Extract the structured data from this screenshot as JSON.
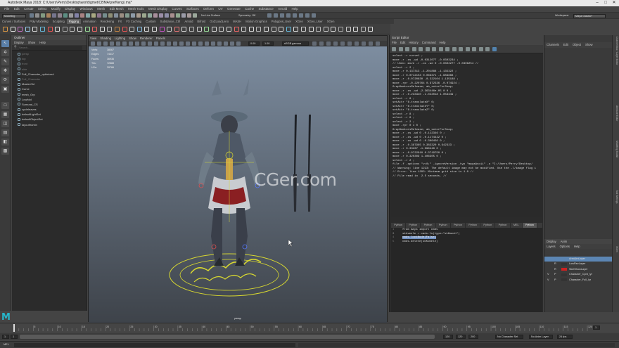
{
  "window": {
    "title": "Autodesk Maya 2018: C:\\Users\\Perry\\Desktop\\world\\gmet\\CBMA\\pref\\leng\\.ma*"
  },
  "menubar": [
    "File",
    "Edit",
    "Create",
    "Select",
    "Modify",
    "Display",
    "Windows",
    "Mesh",
    "Edit Mesh",
    "Mesh Tools",
    "Mesh Display",
    "Curves",
    "Surfaces",
    "Deform",
    "UV",
    "Generate",
    "Cache",
    "Substance",
    "Arnold",
    "Help"
  ],
  "status": {
    "mode": "Modeling",
    "live_surface": "No Live Surface",
    "symmetry": "Symmetry: Off",
    "workspace_label": "Workspace:",
    "workspace": "Maya Classic*"
  },
  "shelf_tabs": [
    {
      "label": "Curves / Surfaces"
    },
    {
      "label": "Poly Modeling"
    },
    {
      "label": "Sculpting"
    },
    {
      "label": "Rigging",
      "active": true
    },
    {
      "label": "Animation"
    },
    {
      "label": "Rendering"
    },
    {
      "label": "FX"
    },
    {
      "label": "FX Caching"
    },
    {
      "label": "Custom"
    },
    {
      "label": "Substance_Ctrl"
    },
    {
      "label": "Arnold"
    },
    {
      "label": "Bifrost"
    },
    {
      "label": "GoZLoadLeno"
    },
    {
      "label": "MASH"
    },
    {
      "label": "Motion Graphics"
    },
    {
      "label": "Polygons_User"
    },
    {
      "label": "XGen"
    },
    {
      "label": "XGen_User"
    },
    {
      "label": "XGen"
    }
  ],
  "outliner": {
    "title": "Outliner",
    "menu": [
      "Display",
      "Show",
      "Help"
    ],
    "search_placeholder": "Search...",
    "items": [
      {
        "label": "persp",
        "dim": true
      },
      {
        "label": "top",
        "dim": true
      },
      {
        "label": "front",
        "dim": true
      },
      {
        "label": "side",
        "dim": true
      },
      {
        "label": "Full_Character_optimized"
      },
      {
        "label": "Full_Character",
        "dim": true
      },
      {
        "label": "MasterCtrl"
      },
      {
        "label": "Curve"
      },
      {
        "label": "mesh_Grp"
      },
      {
        "label": "Lowfold"
      },
      {
        "label": "Sumurai_CS"
      },
      {
        "label": "cycleleaves"
      },
      {
        "label": "defaultLightSet"
      },
      {
        "label": "defaultObjectSet"
      },
      {
        "label": "layoutfromin"
      }
    ]
  },
  "viewport": {
    "menu": [
      "View",
      "Shading",
      "Lighting",
      "Show",
      "Renderer",
      "Panels"
    ],
    "hud": [
      [
        "Verts:",
        "38067"
      ],
      [
        "Edges:",
        "74417"
      ],
      [
        "Faces:",
        "36936"
      ],
      [
        "Tris:",
        "72888"
      ],
      [
        "UVs:",
        "39766"
      ]
    ],
    "camera": "persp",
    "cs_value": "0.00",
    "cs_value2": "1.00",
    "colorspace": "sRGB gamma"
  },
  "watermark": "CGer.com",
  "script_editor": {
    "title": "Script Editor",
    "menu": [
      "File",
      "Edit",
      "History",
      "Command",
      "Help"
    ],
    "history": [
      "select -r curve1 ;",
      "move -r -os -wd -0.0312077 -0.0303234 ;",
      "// Undo: move -r -os -wd 0 -0.0302277 -0.0306254 //",
      "select -r 2 ;",
      "move -r 0.137313 -1.201888 -1.135322 ;",
      "move -r 0.0712153 0.069371 -1.689888 ;",
      "move -r -0.0720630 -0.322104 1.135188 ;",
      "move -rpr -0.220764 0.972336 -0.074924 ;",
      "GrapGnmtorsRelease; ab_sotorForSnap;",
      "move -r -os -wd -2.363446e-05 0 0 ;",
      "move -r -0.233340 -1.022018 1.056349 ;",
      "select -r 8 ;",
      "setAttr \"8.translateX\" 0;",
      "setAttr \"8.translateY\" 0;",
      "setAttr \"8.translateZ\" 0;",
      "select -r 8 ;",
      "select -r 8 ;",
      "select -r 2 ;",
      "move -rpr 0 1 0 ;",
      "GrapGnmtorsRelease; ab_sotorForSnap;",
      "move -r -os -wd 0 -0.112346 0 ;",
      "move -r -os -wd 0 -0.1174422 0 ;",
      "move -r -os -wd 0 -0.300450 0 ;",
      "move -r -0.387985 0.383320 0.942323 ;",
      "move -r 0.33267 -1.096448 0 ;",
      "move -r -0.0722910 0.3719750 0 ;",
      "move -r 0.320309 1.406305 0 ;",
      "select -r 2 ;",
      "file -f -options \"v=0;\" -ignoreVersion -typ \"mayaAscii\" -o \"C:/Users/Perry/Desktop/",
      "// Warning: line 1223: The default image may not be modified. Use the -l/image flag i",
      "// Error: line 1293: Minimum grid size is 1.0 //",
      "// File read in  2.5 seconds. //"
    ],
    "tabs": [
      {
        "label": "Python"
      },
      {
        "label": "Python"
      },
      {
        "label": "Python"
      },
      {
        "label": "Python"
      },
      {
        "label": "Python"
      },
      {
        "label": "Python"
      },
      {
        "label": "Python"
      },
      {
        "label": "Python"
      },
      {
        "label": "MEL"
      },
      {
        "label": "Python",
        "active": true
      }
    ],
    "input_lines": [
      "from maya import cmds",
      "",
      "skkvmele = cmds.ls(type=\"skKmesh\")",
      "cmds.lockNode(False)",
      "cmds.delete(skKvmele)"
    ]
  },
  "channel_box": {
    "menu": [
      "Channels",
      "Edit",
      "Object",
      "Show"
    ]
  },
  "layer_editor": {
    "tabs": [
      "Display",
      "Anim"
    ],
    "menu": [
      "Layers",
      "Options",
      "Help"
    ],
    "layers": [
      {
        "v": "",
        "p": "",
        "color": "#5c86b4",
        "name": "ArmAimLayer",
        "selected": true
      },
      {
        "v": "",
        "p": "R",
        "color": "#333333",
        "name": "LowRezLayer"
      },
      {
        "v": "",
        "p": "R",
        "color": "#cc2222",
        "name": "SkelShowLayer"
      },
      {
        "v": "V",
        "p": "P",
        "color": "#333333",
        "name": "Character_Cpnt_lyr"
      },
      {
        "v": "V",
        "p": "P",
        "color": "#333333",
        "name": "Character_Full_lyr"
      }
    ]
  },
  "side_tabs": [
    "Channel Box / Layer Editor",
    "Attribute Editor",
    "Modeling Toolkit",
    "Tool Settings",
    "XGen"
  ],
  "time_slider": {
    "ticks": [
      "5",
      "10",
      "15",
      "20",
      "25",
      "30",
      "35",
      "40",
      "45",
      "50",
      "55",
      "60",
      "65",
      "70",
      "75",
      "80",
      "85",
      "90",
      "95",
      "100",
      "105",
      "110",
      "115",
      "120"
    ],
    "current": "1"
  },
  "range_slider": {
    "start": "1",
    "start2": "1",
    "end": "120",
    "end2": "120",
    "end3": "200",
    "char_set": "No Character Set",
    "anim_layer": "No Anim Layer",
    "fps": "24 fps"
  },
  "command_line": {
    "lang": "MEL"
  },
  "colors": {
    "accent": "#5c86b4",
    "maya_logo": "#27b5c9",
    "gizmo_yellow": "#d8d830"
  }
}
